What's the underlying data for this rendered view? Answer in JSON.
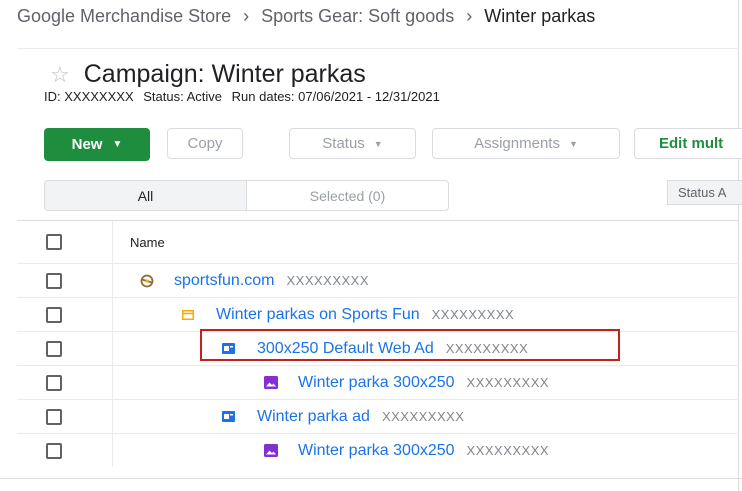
{
  "breadcrumb": {
    "items": [
      "Google Merchandise Store",
      "Sports Gear: Soft goods",
      "Winter parkas"
    ]
  },
  "campaign": {
    "title": "Campaign: Winter parkas",
    "id_label": "ID:",
    "id_value": "XXXXXXXX",
    "status_label": "Status:",
    "status_value": "Active",
    "run_dates_label": "Run dates:",
    "run_dates_value": "07/06/2021 - 12/31/2021"
  },
  "toolbar": {
    "new_label": "New",
    "copy_label": "Copy",
    "status_label": "Status",
    "assignments_label": "Assignments",
    "edit_label": "Edit mult"
  },
  "filter": {
    "all_label": "All",
    "selected_label": "Selected (0)",
    "status_chip": "Status A"
  },
  "table": {
    "header_name": "Name",
    "rows": [
      {
        "name": "sportsfun.com",
        "id": "XXXXXXXXX",
        "icon": "site-icon"
      },
      {
        "name": "Winter parkas on Sports Fun",
        "id": "XXXXXXXXX",
        "icon": "placement-folder-icon"
      },
      {
        "name": "300x250 Default Web Ad",
        "id": "XXXXXXXXX",
        "icon": "ad-icon"
      },
      {
        "name": "Winter parka 300x250",
        "id": "XXXXXXXXX",
        "icon": "creative-image-icon"
      },
      {
        "name": "Winter parka ad",
        "id": "XXXXXXXXX",
        "icon": "ad-icon"
      },
      {
        "name": "Winter parka 300x250",
        "id": "XXXXXXXXX",
        "icon": "creative-image-icon"
      }
    ]
  },
  "colors": {
    "accent_green": "#1e8e3e",
    "link_blue": "#1a73e8",
    "highlight_red": "#c5221f",
    "folder_orange": "#f9ab00",
    "creative_purple": "#8430ce",
    "site_brown": "#8d6e3f"
  }
}
